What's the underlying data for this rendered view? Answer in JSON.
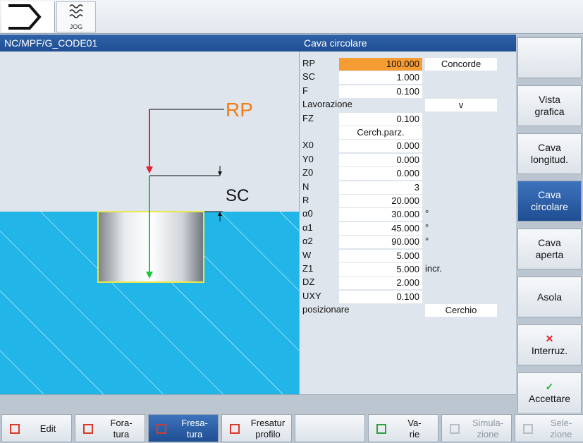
{
  "header": {
    "jog_label": "JOG",
    "path": "NC/MPF/G_CODE01",
    "cycle_title": "Cava circolare"
  },
  "graphic": {
    "rp_label": "RP",
    "sc_label": "SC"
  },
  "params": [
    {
      "name": "RP",
      "value": "100.000",
      "extra": "Concorde"
    },
    {
      "name": "SC",
      "value": "1.000"
    },
    {
      "name": "F",
      "value": "0.100"
    },
    {
      "name": "Lavorazione",
      "select": "v"
    },
    {
      "name": "FZ",
      "value": "0.100"
    },
    {
      "name": "",
      "value": "Cerch.parz."
    },
    {
      "name": "X0",
      "value": "0.000"
    },
    {
      "name": "Y0",
      "value": "0.000"
    },
    {
      "name": "Z0",
      "value": "0.000"
    },
    {
      "name": "N",
      "value": "3"
    },
    {
      "name": "R",
      "value": "20.000"
    },
    {
      "name": "α0",
      "value": "30.000",
      "unit": "°"
    },
    {
      "name": "α1",
      "value": "45.000",
      "unit": "°"
    },
    {
      "name": "α2",
      "value": "90.000",
      "unit": "°"
    },
    {
      "name": "W",
      "value": "5.000"
    },
    {
      "name": "Z1",
      "value": "5.000",
      "unit": "incr."
    },
    {
      "name": "DZ",
      "value": "2.000"
    },
    {
      "name": "UXY",
      "value": "0.100"
    },
    {
      "name": "posizionare",
      "extra": "Cerchio"
    }
  ],
  "vsoftkeys": [
    {
      "label": ""
    },
    {
      "label": "Vista\ngrafica"
    },
    {
      "label": "Cava\nlongitud."
    },
    {
      "label": "Cava\ncircolare"
    },
    {
      "label": "Cava\naperta"
    },
    {
      "label": "Asola"
    },
    {
      "label": "Interruz."
    },
    {
      "label": "Accettare"
    }
  ],
  "hsoftkeys": [
    {
      "label": "Edit"
    },
    {
      "label": "Fora-\ntura"
    },
    {
      "label": "Fresa-\ntura"
    },
    {
      "label": "Fresatur\nprofilo"
    },
    {
      "label": ""
    },
    {
      "label": "Va-\nrie"
    },
    {
      "label": "Simula-\nzione"
    },
    {
      "label": "Sele-\nzione"
    }
  ],
  "colors": {
    "accent_blue": "#1f4e93",
    "active_field": "#f59c33",
    "rp_orange": "#f07d1a",
    "water_cyan": "#22b6e8"
  }
}
